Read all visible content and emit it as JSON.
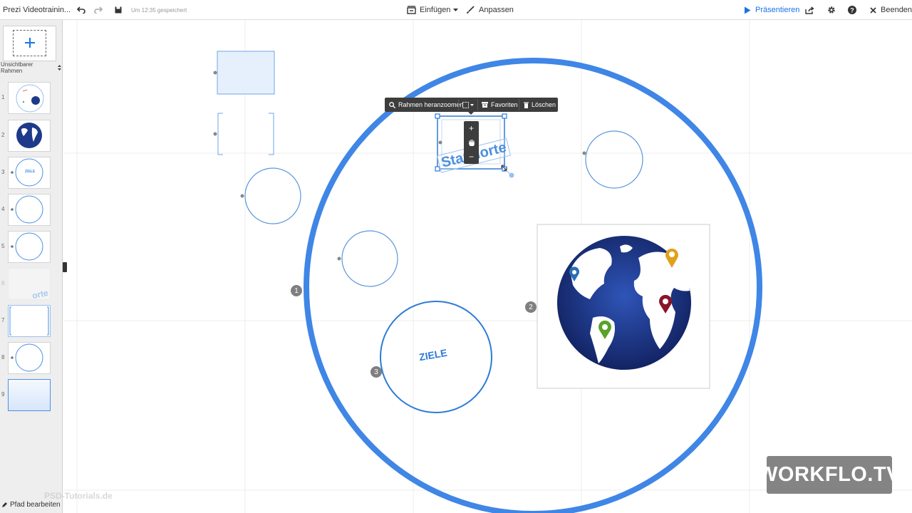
{
  "app": {
    "title": "Prezi Videotrainin...",
    "save_status": "Um 12:35 gespeichert"
  },
  "toolbar": {
    "insert_label": "Einfügen",
    "customize_label": "Anpassen",
    "present_label": "Präsentieren",
    "exit_label": "Beenden"
  },
  "sidebar": {
    "frame_type": "Unsichtbarer Rahmen",
    "slides": [
      "1",
      "2",
      "3",
      "4",
      "5",
      "6",
      "7",
      "8",
      "9"
    ],
    "slide3_text": "ZIELE",
    "edit_path_label": "Pfad bearbeiten"
  },
  "context_toolbar": {
    "zoom_label": "Rahmen heranzoomen",
    "favorites_label": "Favoriten",
    "delete_label": "Löschen"
  },
  "zoom_control": {
    "plus": "+",
    "minus": "−"
  },
  "canvas": {
    "selected_text": "Standorte",
    "ziele_text": "ZIELE",
    "path_badges": [
      "1",
      "2",
      "3"
    ]
  },
  "watermark": {
    "text": "WORKFLO.TV",
    "sub": "PSD-Tutorials.de"
  },
  "colors": {
    "accent": "#1a73e8",
    "frame_blue": "#4a90e2",
    "ring_blue": "#3f86e6",
    "globe": "#1d3a8a"
  }
}
